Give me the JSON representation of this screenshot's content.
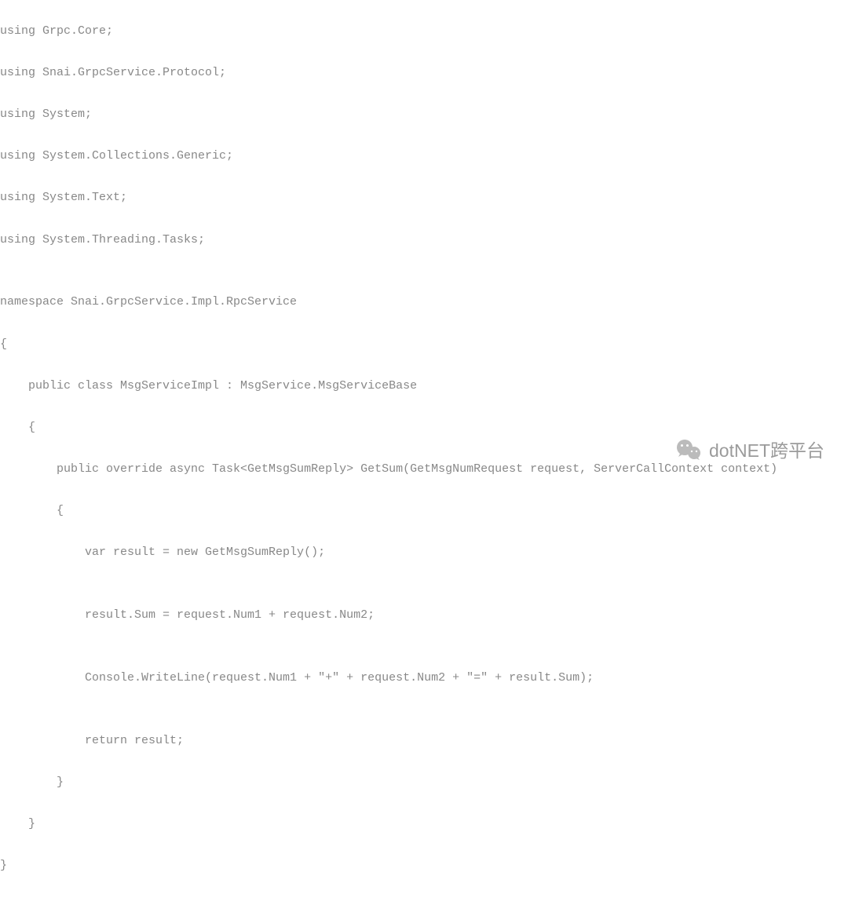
{
  "code": {
    "lines": [
      "using Grpc.Core;",
      "using Snai.GrpcService.Protocol;",
      "using System;",
      "using System.Collections.Generic;",
      "using System.Text;",
      "using System.Threading.Tasks;",
      "",
      "namespace Snai.GrpcService.Impl.RpcService",
      "{",
      "    public class MsgServiceImpl : MsgService.MsgServiceBase",
      "    {",
      "        public override async Task<GetMsgSumReply> GetSum(GetMsgNumRequest request, ServerCallContext context)",
      "        {",
      "            var result = new GetMsgSumReply();",
      "",
      "            result.Sum = request.Num1 + request.Num2;",
      "",
      "            Console.WriteLine(request.Num1 + \"+\" + request.Num2 + \"=\" + result.Sum);",
      "",
      "            return result;",
      "        }",
      "    }",
      "}"
    ]
  },
  "watermark": {
    "text": "dotNET跨平台",
    "icon": "wechat-icon"
  }
}
